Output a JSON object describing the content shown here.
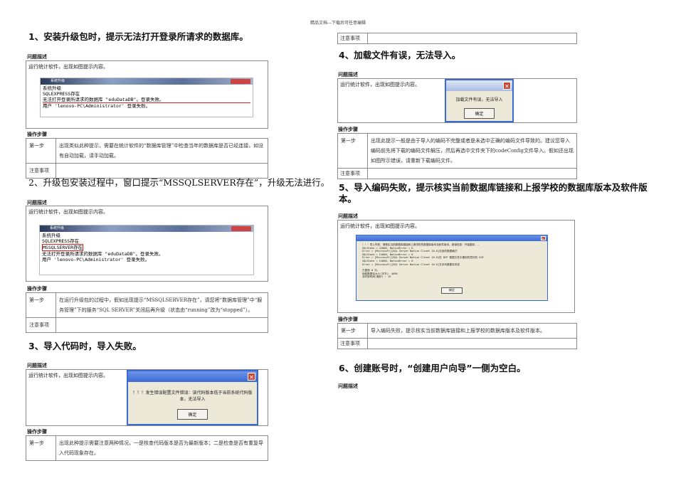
{
  "header": "精品文档---下载后可任意编辑",
  "labels": {
    "problem": "问题描述",
    "steps": "操作步骤",
    "step1": "第一步",
    "notes": "注意事项",
    "run_text": "运行统计软件，出现如图提示内容。"
  },
  "s1": {
    "title": "1、安装升级包时，提示无法打开登录所请求的数据库。",
    "win_title": "系统升级",
    "lines": [
      "系统升级",
      "SQLEXPRESS存在",
      "无法打开登录所请求的数据库 \"eduDataDB\"。登录失败。",
      "用户 'lenovo-PC\\Administrator' 登录失败。"
    ],
    "step": "出现类似此种提示，需要在统计软件的“数据库管理”中检查当年的数据库是否已经连接，如没有自动加载，请手动加载。"
  },
  "s2": {
    "title": "2、升级包安装过程中，窗口提示“MSSQLSERVER存在”，升级无法进行。",
    "win_title": "系统升级",
    "lines": [
      "系统升级",
      "SQLEXPRESS存在",
      "MSSQLSERVER存在",
      "无法打开登录所请求的数据库 \"eduDataDB\"。登录失败。",
      "用户 'lenovo-PC\\Administrator' 登录失败。"
    ],
    "step": "在运行升级包的过程中，假如出现提示“MSSQLSERVER存在”，请您将“数据库管理”中“服务管理”下的服务“SQL SERVER”关闭后再升级（状态由“running”改为“stopped”）。"
  },
  "s3": {
    "title": "3、导入代码时，导入失败。",
    "msg": "！！！发生错误配置文件错误：该代码版本低于当前系统代码版本，无法导入",
    "ok": "确定",
    "step": "出现此种提示需要注意两种情况，一是核查代码版本是否为最新版本；二是检查是否有重复导入代码现象存在。"
  },
  "s4": {
    "title": "4、加载文件有误，无法导入。",
    "msg": "加载文件有误，无法导入",
    "ok": "确定",
    "step": "出现此提示一般是由于导入的编码不完整或者是未选中正确的编码文件导致的。建议您导入编码前先将下载的编码文件解压，然后再选中文件夹下的codeConfig文件导入。假如还出现如图所示错误，请重新下载编码文件。"
  },
  "s5": {
    "title": "5、导入编码失败，提示核实当前数据库链接和上报学校的数据库版本及软件版本。",
    "lines": [
      "！！！导入失败，请核实当前数据库链接和上报学校的数据库版本及软件版本。错误信息：开始复制...",
      "SQLState = 22008, NativeError = 0",
      "Error = [Microsoft][SQL Server Native Client 10.0]无效的数据格式",
      "SQLState = S1000, NativeError = 0",
      "Error = [Microsoft][SQL Server Native Client 10.0]在 BCP 数据文件中遇到的意外的 EOF",
      "SQLState = S1000, NativeError = 0",
      "Error = [Microsoft][SQL Server Native Client 10.0]文本列数据未完成",
      "",
      "已复制 0 行。",
      "网络数据包大小(字节): 4096",
      "总时钟时间(毫秒)     : 15"
    ],
    "ok": "确定",
    "step": "导入编码失败，提示核实当前数据库链接和上报学校的数据库版本及软件版本。"
  },
  "s6": {
    "title": "6、创建账号时，“创建用户向导”一侧为空白。"
  }
}
